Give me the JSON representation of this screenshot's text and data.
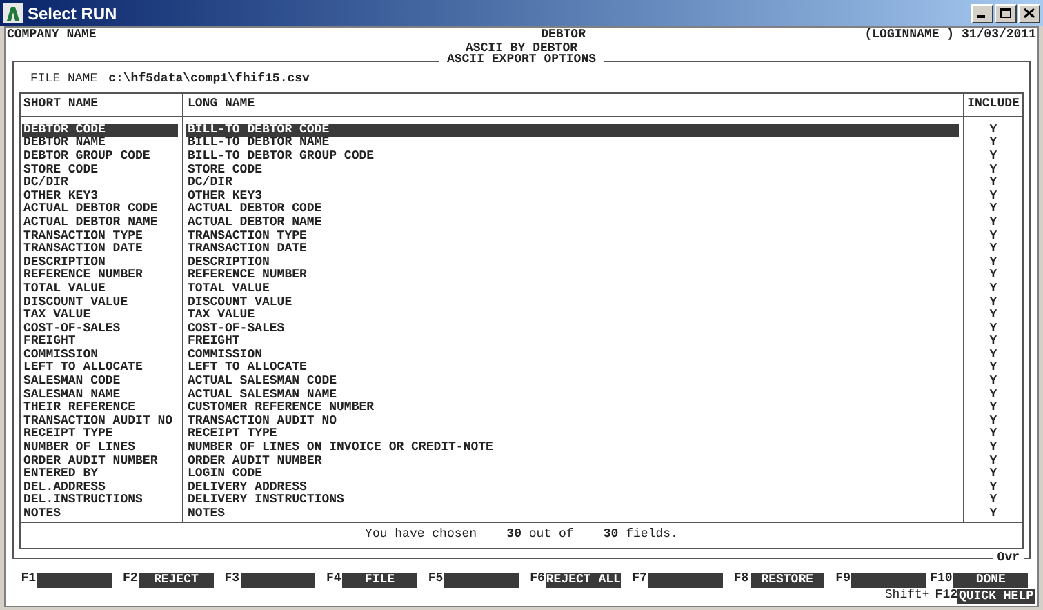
{
  "window": {
    "title": "Select RUN"
  },
  "header": {
    "company": "COMPANY NAME",
    "module": "DEBTOR",
    "user_date": "(LOGINNAME ) 31/03/2011",
    "subtitle": "ASCII BY DEBTOR"
  },
  "panel": {
    "title": "ASCII EXPORT OPTIONS",
    "file_label": "FILE NAME",
    "file_value": "c:\\hf5data\\comp1\\fhif15.csv"
  },
  "table": {
    "columns": [
      "SHORT NAME",
      "LONG NAME",
      "INCLUDE"
    ],
    "rows": [
      {
        "short": "DEBTOR CODE",
        "long": "BILL-TO DEBTOR CODE",
        "include": "Y",
        "selected": true
      },
      {
        "short": "DEBTOR NAME",
        "long": "BILL-TO DEBTOR NAME",
        "include": "Y",
        "selected": false
      },
      {
        "short": "DEBTOR GROUP CODE",
        "long": "BILL-TO DEBTOR GROUP CODE",
        "include": "Y",
        "selected": false
      },
      {
        "short": "STORE CODE",
        "long": "STORE CODE",
        "include": "Y",
        "selected": false
      },
      {
        "short": "DC/DIR",
        "long": "DC/DIR",
        "include": "Y",
        "selected": false
      },
      {
        "short": "OTHER KEY3",
        "long": "OTHER KEY3",
        "include": "Y",
        "selected": false
      },
      {
        "short": "ACTUAL DEBTOR CODE",
        "long": "ACTUAL DEBTOR CODE",
        "include": "Y",
        "selected": false
      },
      {
        "short": "ACTUAL DEBTOR NAME",
        "long": "ACTUAL DEBTOR NAME",
        "include": "Y",
        "selected": false
      },
      {
        "short": "TRANSACTION TYPE",
        "long": "TRANSACTION TYPE",
        "include": "Y",
        "selected": false
      },
      {
        "short": "TRANSACTION DATE",
        "long": "TRANSACTION DATE",
        "include": "Y",
        "selected": false
      },
      {
        "short": "DESCRIPTION",
        "long": "DESCRIPTION",
        "include": "Y",
        "selected": false
      },
      {
        "short": "REFERENCE NUMBER",
        "long": "REFERENCE NUMBER",
        "include": "Y",
        "selected": false
      },
      {
        "short": "TOTAL VALUE",
        "long": "TOTAL VALUE",
        "include": "Y",
        "selected": false
      },
      {
        "short": "DISCOUNT VALUE",
        "long": "DISCOUNT VALUE",
        "include": "Y",
        "selected": false
      },
      {
        "short": "TAX VALUE",
        "long": "TAX VALUE",
        "include": "Y",
        "selected": false
      },
      {
        "short": "COST-OF-SALES",
        "long": "COST-OF-SALES",
        "include": "Y",
        "selected": false
      },
      {
        "short": "FREIGHT",
        "long": "FREIGHT",
        "include": "Y",
        "selected": false
      },
      {
        "short": "COMMISSION",
        "long": "COMMISSION",
        "include": "Y",
        "selected": false
      },
      {
        "short": "LEFT TO ALLOCATE",
        "long": "LEFT TO ALLOCATE",
        "include": "Y",
        "selected": false
      },
      {
        "short": "SALESMAN CODE",
        "long": "ACTUAL SALESMAN CODE",
        "include": "Y",
        "selected": false
      },
      {
        "short": "SALESMAN NAME",
        "long": "ACTUAL SALESMAN NAME",
        "include": "Y",
        "selected": false
      },
      {
        "short": "THEIR REFERENCE",
        "long": "CUSTOMER REFERENCE NUMBER",
        "include": "Y",
        "selected": false
      },
      {
        "short": "TRANSACTION AUDIT NO",
        "long": "TRANSACTION AUDIT NO",
        "include": "Y",
        "selected": false
      },
      {
        "short": "RECEIPT TYPE",
        "long": "RECEIPT TYPE",
        "include": "Y",
        "selected": false
      },
      {
        "short": "NUMBER OF LINES",
        "long": "NUMBER OF LINES ON INVOICE OR CREDIT-NOTE",
        "include": "Y",
        "selected": false
      },
      {
        "short": "ORDER AUDIT NUMBER",
        "long": "ORDER AUDIT NUMBER",
        "include": "Y",
        "selected": false
      },
      {
        "short": "ENTERED BY",
        "long": "LOGIN CODE",
        "include": "Y",
        "selected": false
      },
      {
        "short": "DEL.ADDRESS",
        "long": "DELIVERY ADDRESS",
        "include": "Y",
        "selected": false
      },
      {
        "short": "DEL.INSTRUCTIONS",
        "long": "DELIVERY INSTRUCTIONS",
        "include": "Y",
        "selected": false
      },
      {
        "short": "NOTES",
        "long": "NOTES",
        "include": "Y",
        "selected": false
      }
    ]
  },
  "summary": {
    "prefix": "You have chosen",
    "chosen": "30",
    "middle": "out of",
    "total": "30",
    "suffix": "fields."
  },
  "mode": "Ovr",
  "function_keys": [
    {
      "key": "F1"
    },
    {
      "key": "F2",
      "label": "REJECT"
    },
    {
      "key": "F3"
    },
    {
      "key": "F4",
      "label": "FILE"
    },
    {
      "key": "F5"
    },
    {
      "key": "F6",
      "label": "REJECT ALL"
    },
    {
      "key": "F7"
    },
    {
      "key": "F8",
      "label": "RESTORE"
    },
    {
      "key": "F9"
    },
    {
      "key": "F10",
      "label": "DONE"
    }
  ],
  "shift_key": {
    "prefix": "Shift+",
    "key": "F12",
    "label": "QUICK HELP"
  }
}
